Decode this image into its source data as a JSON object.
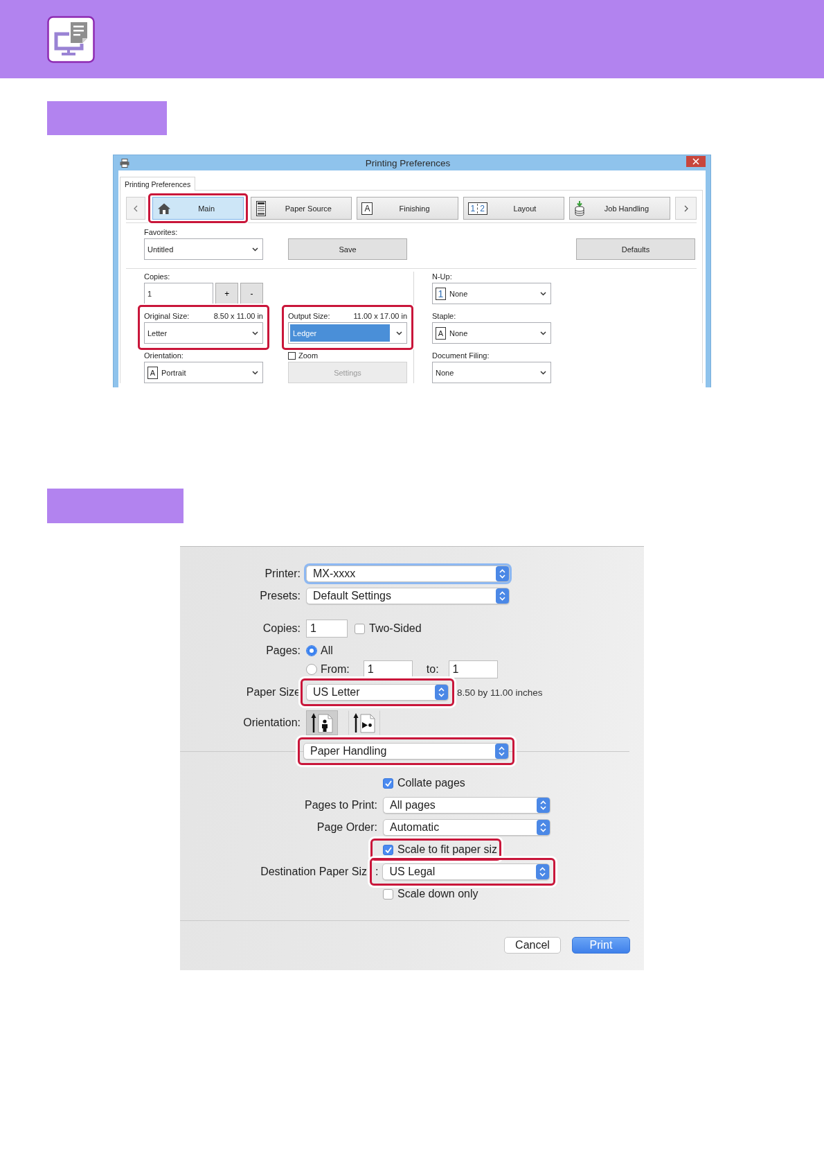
{
  "windows_dialog": {
    "title": "Printing Preferences",
    "page_tab": "Printing Preferences",
    "nav_tabs": [
      {
        "kind": "home",
        "label": "Main",
        "selected": true,
        "highlighted": true
      },
      {
        "kind": "tray",
        "label": "Paper Source",
        "selected": false,
        "highlighted": false
      },
      {
        "kind": "letter",
        "icon_text": [
          "A"
        ],
        "label": "Finishing",
        "selected": false,
        "highlighted": false
      },
      {
        "kind": "pages",
        "icon_text": [
          "1",
          "2"
        ],
        "label": "Layout",
        "selected": false,
        "highlighted": false
      },
      {
        "kind": "stack",
        "label": "Job Handling",
        "selected": false,
        "highlighted": false
      }
    ],
    "favorites": {
      "label": "Favorites:",
      "value": "Untitled"
    },
    "save_button": "Save",
    "defaults_button": "Defaults",
    "copies": {
      "label": "Copies:",
      "value": "1",
      "increment": "+",
      "decrement": "-"
    },
    "n_up": {
      "label": "N-Up:",
      "icon_text": "1",
      "value": "None"
    },
    "original_size": {
      "label": "Original Size:",
      "dimensions": "8.50 x 11.00 in",
      "value": "Letter",
      "focused": false,
      "highlighted": true
    },
    "output_size": {
      "label": "Output Size:",
      "dimensions": "11.00 x 17.00 in",
      "value": "Ledger",
      "focused": true,
      "highlighted": true
    },
    "staple": {
      "label": "Staple:",
      "icon_text": "A",
      "value": "None"
    },
    "orientation": {
      "label": "Orientation:",
      "icon_text": "A",
      "value": "Portrait"
    },
    "zoom": {
      "label": "Zoom",
      "checked": false
    },
    "settings_button": {
      "label": "Settings",
      "disabled": true
    },
    "document_filing": {
      "label": "Document Filing:",
      "value": "None"
    }
  },
  "mac_dialog": {
    "rows": [
      {
        "kind": "popup",
        "label": "Printer:",
        "value": "MX-xxxx",
        "focused": true,
        "highlighted": false
      },
      {
        "kind": "popup",
        "label": "Presets:",
        "value": "Default Settings",
        "focused": false,
        "highlighted": false
      },
      {
        "kind": "copies",
        "label": "Copies:",
        "value": "1",
        "option": {
          "label": "Two-Sided",
          "checked": false
        }
      },
      {
        "kind": "pages",
        "label": "Pages:",
        "choices": [
          {
            "label": "All",
            "selected": true
          },
          {
            "label": "From:",
            "selected": false
          }
        ],
        "from": "1",
        "to_label": "to:",
        "to": "1"
      },
      {
        "kind": "popup",
        "label": "Paper Size",
        "value": "US Letter",
        "note": "8.50 by 11.00 inches",
        "focused": false,
        "highlighted": true
      },
      {
        "kind": "orientation",
        "label": "Orientation:",
        "choices": [
          {
            "kind": "portrait",
            "selected": true
          },
          {
            "kind": "landscape",
            "selected": false
          }
        ]
      }
    ],
    "panel_menu": {
      "value": "Paper Handling",
      "highlighted": true
    },
    "panel_rows": [
      {
        "kind": "checkbox",
        "label": "Collate pages",
        "checked": true,
        "highlighted": false
      },
      {
        "kind": "popup",
        "label": "Pages to Print:",
        "value": "All pages",
        "highlighted": false
      },
      {
        "kind": "popup",
        "label": "Page Order:",
        "value": "Automatic",
        "highlighted": false
      },
      {
        "kind": "checkbox",
        "label": "Scale to fit paper siz",
        "checked": true,
        "highlighted": true
      },
      {
        "kind": "popup",
        "label": "Destination Paper Siz",
        "label_tail": ":",
        "value": "US Legal",
        "highlighted": true
      },
      {
        "kind": "checkbox",
        "label": "Scale down only",
        "checked": false,
        "highlighted": false
      }
    ],
    "buttons": [
      {
        "label": "Cancel",
        "default": false
      },
      {
        "label": "Print",
        "default": true
      }
    ]
  }
}
